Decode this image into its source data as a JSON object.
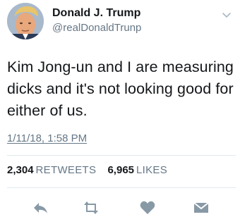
{
  "tweet": {
    "author": {
      "display_name": "Donald J. Trump",
      "handle": "@realDonaldTrunp"
    },
    "text": "Kim Jong-un and I are measuring dicks and it's not looking good for either of us.",
    "timestamp": "1/11/18, 1:58 PM",
    "stats": {
      "retweets_count": "2,304",
      "retweets_label": "RETWEETS",
      "likes_count": "6,965",
      "likes_label": "LIKES"
    }
  },
  "icons": {
    "avatar": "profile-photo",
    "menu": "chevron-down-icon",
    "reply": "reply-icon",
    "retweet": "retweet-icon",
    "like": "heart-icon",
    "message": "envelope-icon"
  },
  "colors": {
    "text_primary": "#14171a",
    "text_secondary": "#657786",
    "icon": "#8899a6",
    "divider": "#e1e8ed"
  }
}
